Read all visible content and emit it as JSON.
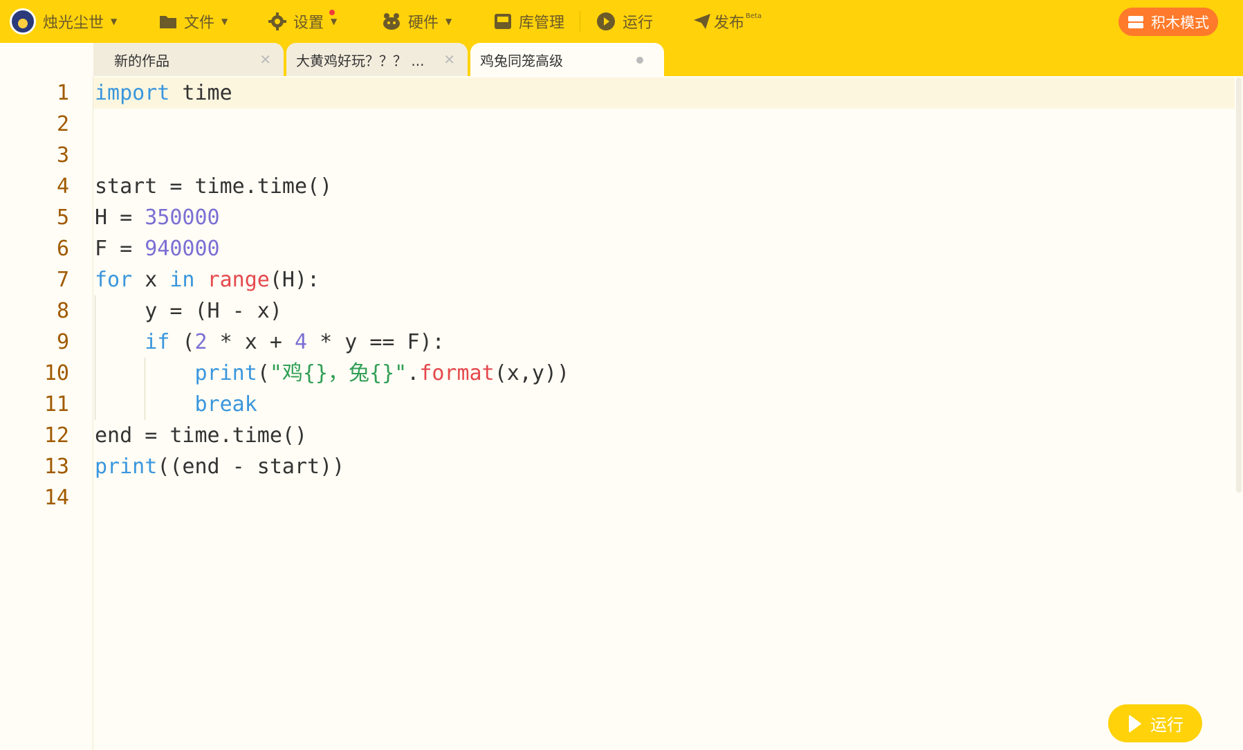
{
  "topbar": {
    "user_name": "烛光尘世",
    "menu": [
      {
        "label": "文件",
        "icon": "folder-icon"
      },
      {
        "label": "设置",
        "icon": "gear-icon"
      },
      {
        "label": "硬件",
        "icon": "robot-icon"
      },
      {
        "label": "库管理",
        "icon": "library-icon"
      },
      {
        "label": "运行",
        "icon": "play-icon"
      },
      {
        "label": "发布",
        "icon": "send-icon",
        "badge": "Beta"
      }
    ],
    "block_mode_label": "积木模式"
  },
  "tabs": [
    {
      "title": "新的作品",
      "state": "inactive"
    },
    {
      "title": "大黄鸡好玩？？？ ...",
      "state": "inactive"
    },
    {
      "title": "鸡兔同笼高级",
      "state": "active-unsaved"
    }
  ],
  "editor": {
    "line_numbers": [
      "1",
      "2",
      "3",
      "4",
      "5",
      "6",
      "7",
      "8",
      "9",
      "10",
      "11",
      "12",
      "13",
      "14"
    ],
    "lines": [
      "import time",
      "",
      "",
      "start = time.time()",
      "H = 350000",
      "F = 940000",
      "for x in range(H):",
      "    y = (H - x)",
      "    if (2 * x + 4 * y == F):",
      "        print(\"鸡{}，兔{}\".format(x,y))",
      "        break",
      "end = time.time()",
      "print((end - start))",
      ""
    ]
  },
  "run_button_label": "运行",
  "colors": {
    "accent": "#ffd20a",
    "block_mode_button": "#ff7a2a",
    "keyword": "#3a96dd",
    "number": "#7b6fd4",
    "function": "#e5484d",
    "string": "#2f9e55",
    "line_number": "#a05a00"
  }
}
